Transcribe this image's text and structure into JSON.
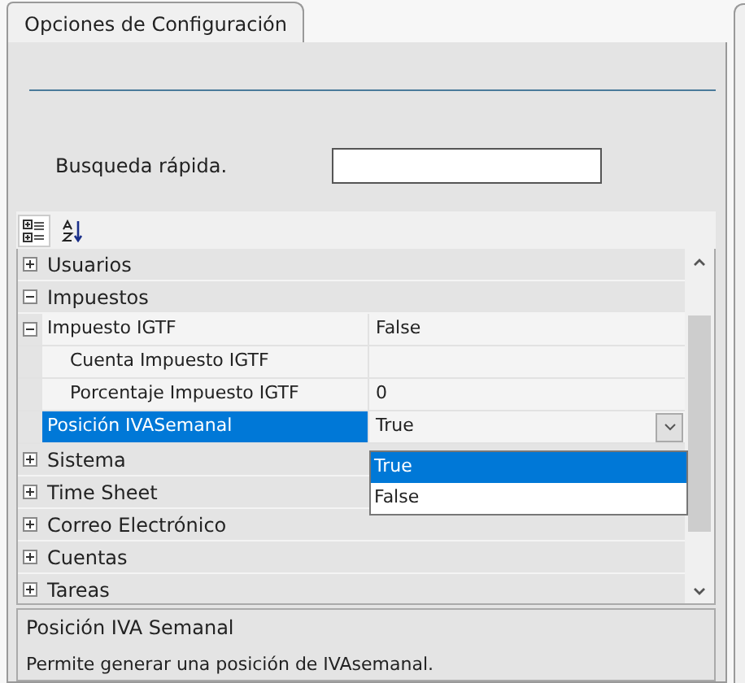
{
  "tab": {
    "label": "Opciones de Configuración",
    "selected": true
  },
  "search": {
    "label": "Busqueda rápida."
  },
  "toolbar": [
    {
      "kind": "categorized",
      "selected": true
    },
    {
      "kind": "alphabetical",
      "selected": false
    }
  ],
  "grid": [
    {
      "kind": "category",
      "name": "Usuarios",
      "expanded": false
    },
    {
      "kind": "category",
      "name": "Impuestos",
      "expanded": true,
      "children": [
        {
          "kind": "property",
          "name": "Impuesto IGTF",
          "value": "False",
          "expanded": true,
          "selected": false,
          "children": [
            {
              "kind": "property",
              "name": "Cuenta Impuesto IGTF",
              "selected": false
            },
            {
              "kind": "property",
              "name": "Porcentaje Impuesto IGTF",
              "value": "0",
              "selected": false
            }
          ]
        },
        {
          "kind": "property",
          "name": "Posición IVASemanal",
          "value": "True",
          "selected": true,
          "dropdown": {
            "open": true,
            "options": [
              {
                "label": "True",
                "selected": true
              },
              {
                "label": "False",
                "selected": false
              }
            ]
          }
        }
      ]
    },
    {
      "kind": "category",
      "name": "Sistema",
      "expanded": false
    },
    {
      "kind": "category",
      "name": "Time Sheet",
      "expanded": false
    },
    {
      "kind": "category",
      "name": "Correo Electrónico",
      "expanded": false
    },
    {
      "kind": "category",
      "name": "Cuentas",
      "expanded": false
    },
    {
      "kind": "category",
      "name": "Tareas",
      "expanded": false
    }
  ],
  "description": {
    "title": "Posición IVA Semanal",
    "text": "Permite generar una posición de IVAsemanal."
  }
}
